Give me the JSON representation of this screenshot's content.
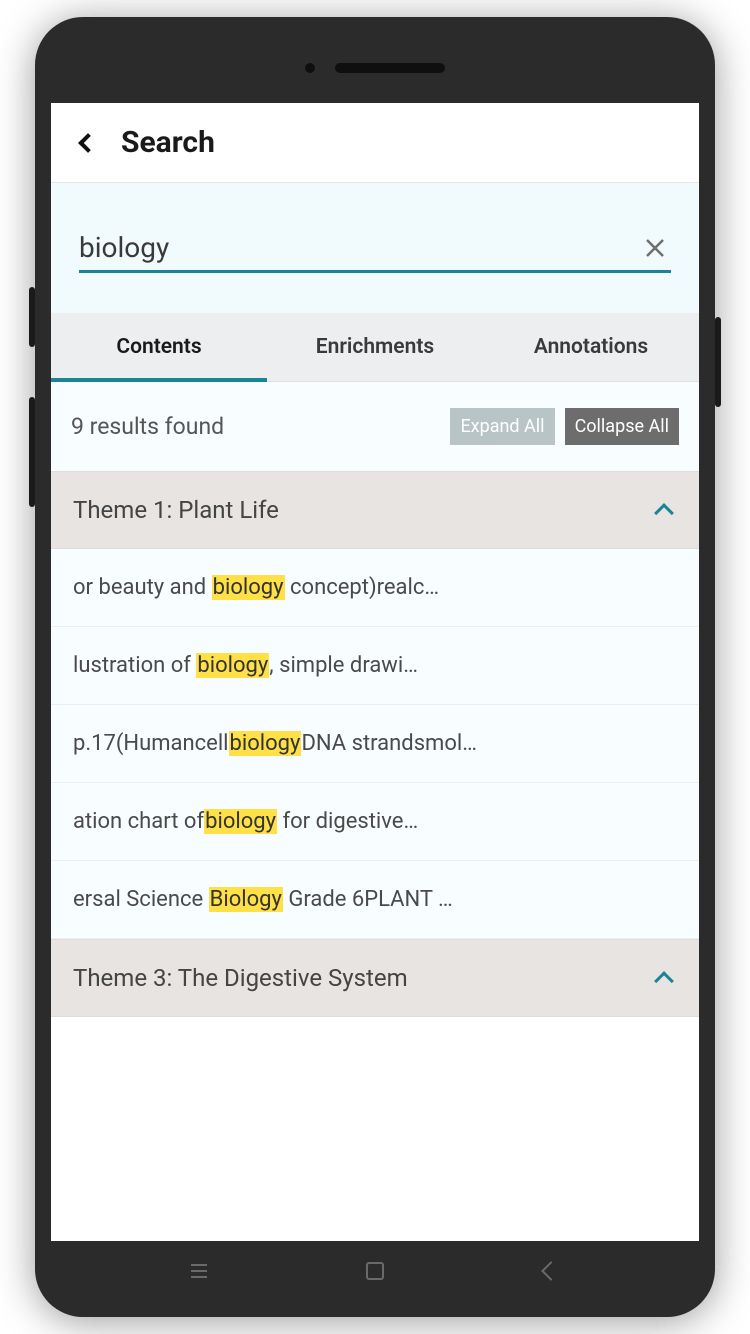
{
  "header": {
    "title": "Search"
  },
  "search": {
    "value": "biology"
  },
  "tabs": {
    "contents": "Contents",
    "enrichments": "Enrichments",
    "annotations": "Annotations"
  },
  "results": {
    "count_label": "9 results found",
    "expand_label": "Expand All",
    "collapse_label": "Collapse All"
  },
  "sections": [
    {
      "title": "Theme 1: Plant Life",
      "items": [
        {
          "pre": "or beauty and ",
          "hl": "biology",
          "post": " concept)realc…"
        },
        {
          "pre": "lustration of ",
          "hl": "biology",
          "post": ", simple drawi…"
        },
        {
          "pre": "p.17(Humancell",
          "hl": "biology",
          "post": "DNA strandsmol…"
        },
        {
          "pre": "ation chart of",
          "hl": "biology",
          "post": " for digestive…"
        },
        {
          "pre": "ersal Science ",
          "hl": "Biology",
          "post": " Grade 6PLANT …"
        }
      ]
    },
    {
      "title": "Theme 3: The Digestive System",
      "items": []
    }
  ],
  "colors": {
    "accent": "#1b8396",
    "highlight": "#ffe046"
  }
}
